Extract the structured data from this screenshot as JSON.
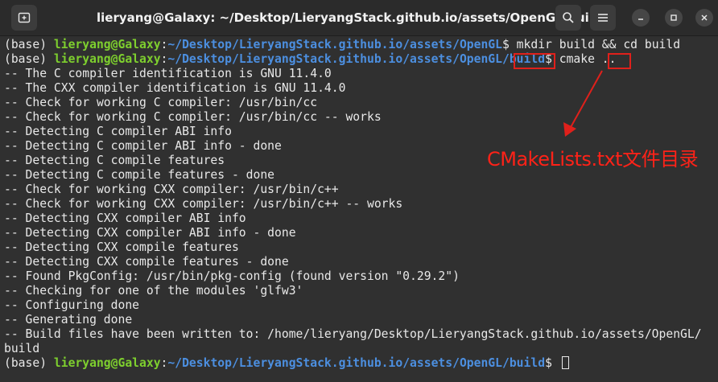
{
  "titlebar": {
    "title": "lieryang@Galaxy: ~/Desktop/LieryangStack.github.io/assets/OpenGL/build"
  },
  "icons": {
    "new_tab": "new-tab-icon",
    "search": "search-icon",
    "menu": "hamburger-menu-icon",
    "minimize": "minimize-icon",
    "maximize": "maximize-icon",
    "close": "close-icon"
  },
  "colors": {
    "user": "#7ecf2e",
    "path": "#4c8fe0",
    "text": "#e8e8e8",
    "annotation": "#e0201b",
    "background": "#303030"
  },
  "terminal": {
    "prompt_env": "(base) ",
    "prompt_user": "lieryang@Galaxy",
    "prompt_colon": ":",
    "cmd1_path": "~/Desktop/LieryangStack.github.io/assets/OpenGL",
    "cmd1_cmd": "$ mkdir build && cd build",
    "cmd2_path": "~/Desktop/LieryangStack.github.io/assets/OpenGL/build",
    "cmd2_cmd": "$ cmake ..",
    "output": [
      "-- The C compiler identification is GNU 11.4.0",
      "-- The CXX compiler identification is GNU 11.4.0",
      "-- Check for working C compiler: /usr/bin/cc",
      "-- Check for working C compiler: /usr/bin/cc -- works",
      "-- Detecting C compiler ABI info",
      "-- Detecting C compiler ABI info - done",
      "-- Detecting C compile features",
      "-- Detecting C compile features - done",
      "-- Check for working CXX compiler: /usr/bin/c++",
      "-- Check for working CXX compiler: /usr/bin/c++ -- works",
      "-- Detecting CXX compiler ABI info",
      "-- Detecting CXX compiler ABI info - done",
      "-- Detecting CXX compile features",
      "-- Detecting CXX compile features - done",
      "-- Found PkgConfig: /usr/bin/pkg-config (found version \"0.29.2\")",
      "-- Checking for one of the modules 'glfw3'",
      "-- Configuring done",
      "-- Generating done",
      "-- Build files have been written to: /home/lieryang/Desktop/LieryangStack.github.io/assets/OpenGL/",
      "build"
    ],
    "cmd3_path": "~/Desktop/LieryangStack.github.io/assets/OpenGL/build",
    "cmd3_cmd": "$ "
  },
  "annotation": {
    "label": "CMakeLists.txt文件目录"
  }
}
